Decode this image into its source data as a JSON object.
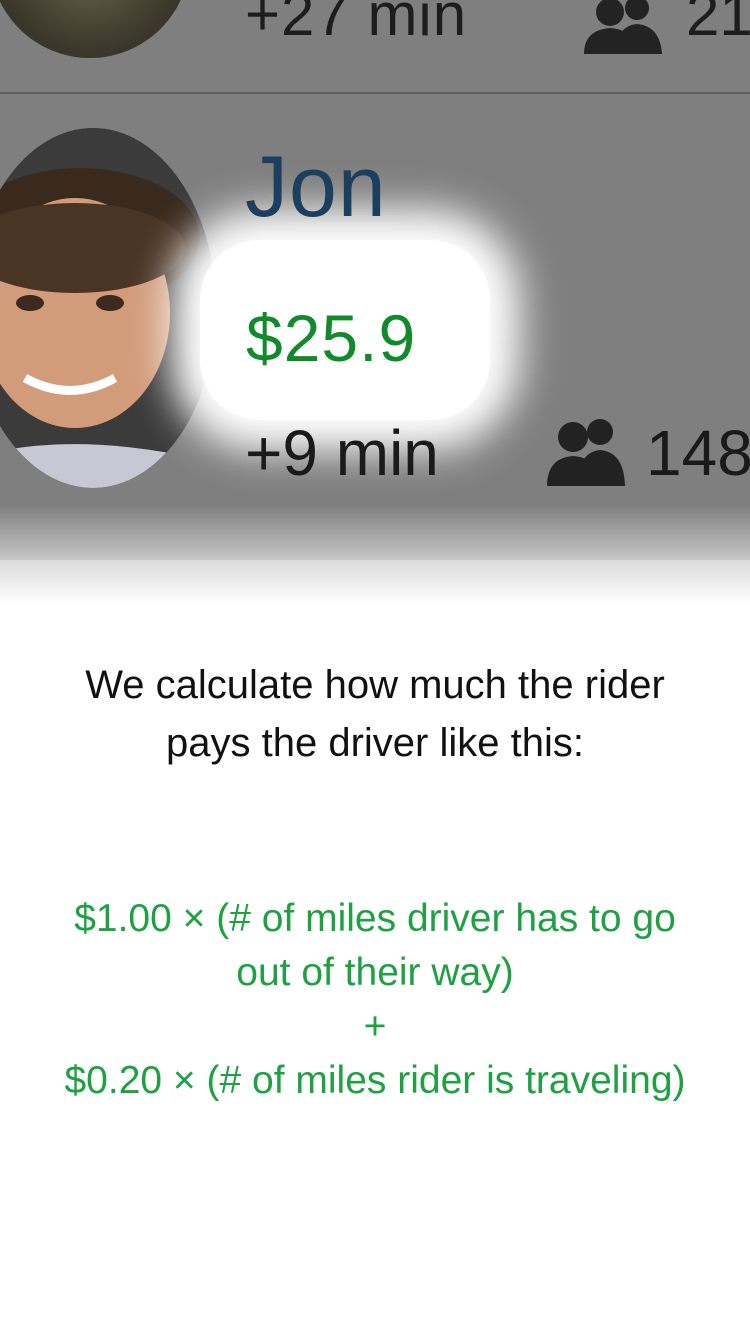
{
  "previous_rider": {
    "time_detour": "+27 min",
    "rating_count": "21"
  },
  "rider": {
    "name": "Jon",
    "price": "$25.9",
    "time_detour": "+9 min",
    "rating_count": "148"
  },
  "onboarding": {
    "intro": "We calculate how much the rider pays the driver like this:",
    "formula": {
      "line1": "$1.00 × (# of miles driver has to go out of their way)",
      "plus": "+",
      "line2": "$0.20 × (# of miles rider is traveling)"
    }
  },
  "colors": {
    "price_green": "#118a2c",
    "formula_green": "#1ea043",
    "name_blue": "#1b3f5c",
    "dim_overlay": "#7f7f7f"
  },
  "icons": {
    "people": "people-icon",
    "avatar": "avatar-photo"
  }
}
